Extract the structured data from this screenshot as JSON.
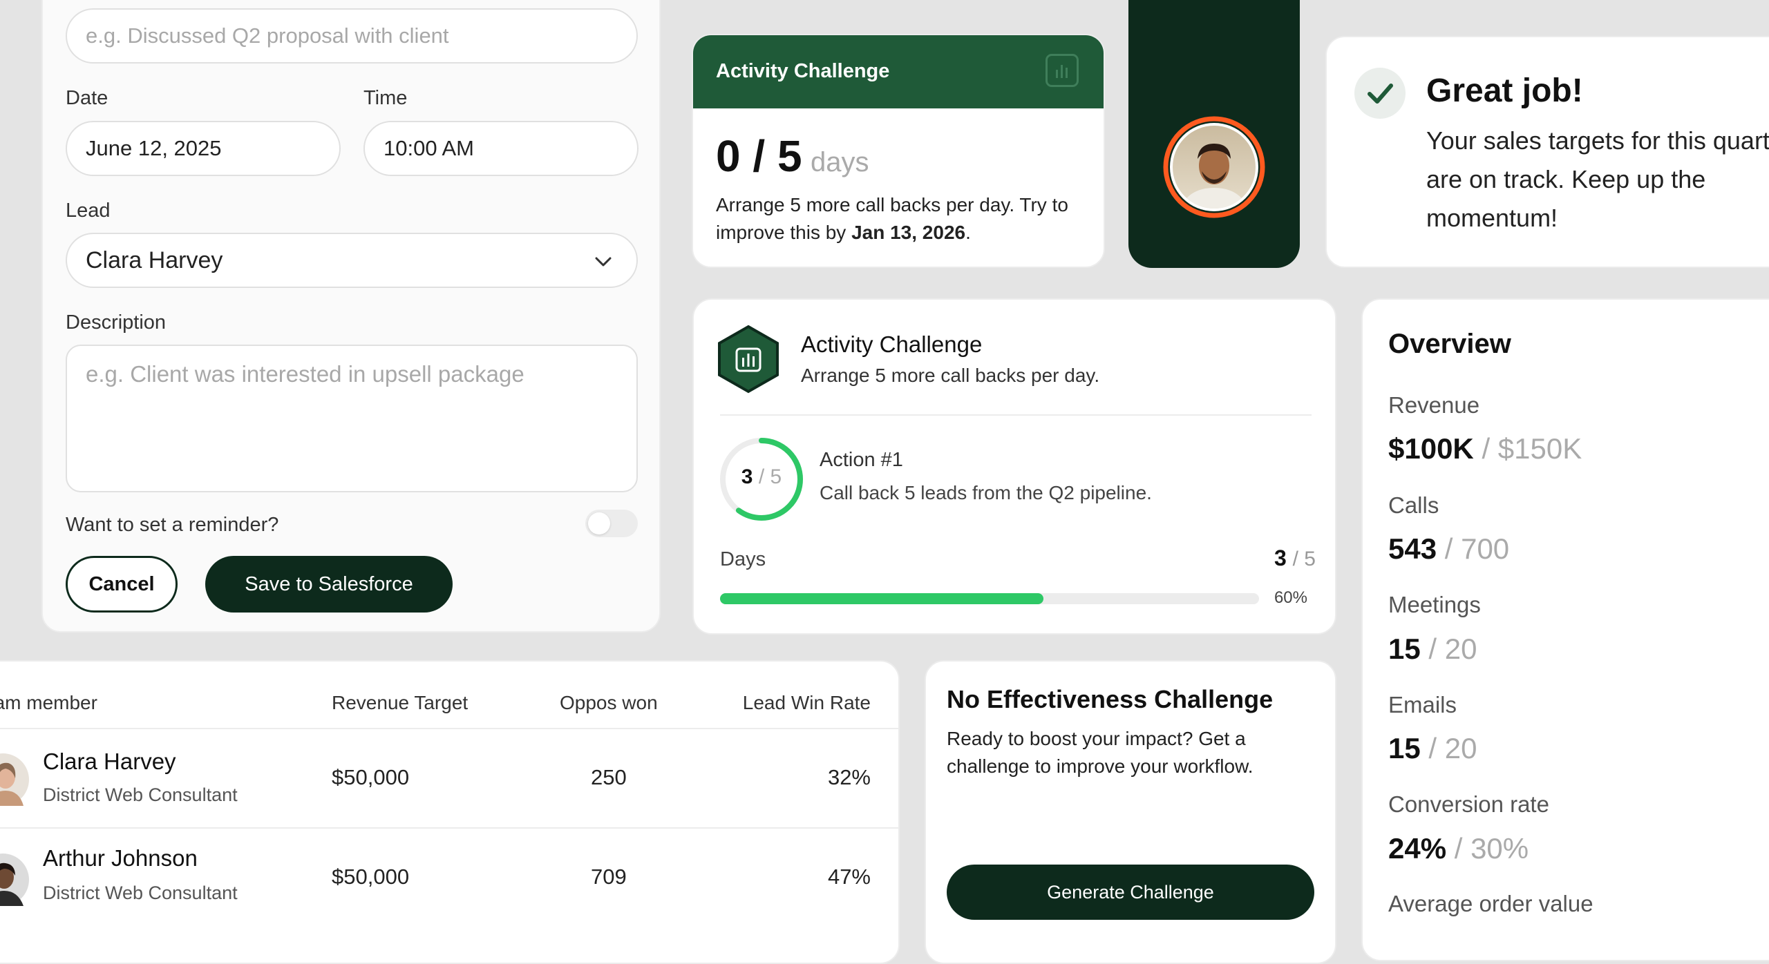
{
  "form": {
    "notes_placeholder": "e.g. Discussed Q2 proposal with client",
    "date_label": "Date",
    "date_value": "June 12, 2025",
    "time_label": "Time",
    "time_value": "10:00 AM",
    "lead_label": "Lead",
    "lead_value": "Clara Harvey",
    "description_label": "Description",
    "description_placeholder": "e.g. Client was interested in upsell package",
    "reminder_label": "Want to set a reminder?",
    "reminder_on": false,
    "cancel_label": "Cancel",
    "save_label": "Save to Salesforce"
  },
  "activity_small": {
    "title": "Activity Challenge",
    "count": "0 / 5",
    "unit": "days",
    "desc_prefix": "Arrange 5 more call backs per day. Try to improve this by ",
    "desc_date": "Jan 13, 2026",
    "desc_suffix": "."
  },
  "great_job": {
    "title": "Great job!",
    "message": "Your sales targets for this quarter are on track. Keep up the momentum!"
  },
  "activity_big": {
    "title": "Activity Challenge",
    "subtitle": "Arrange 5 more call backs per day.",
    "ring_done": "3",
    "ring_total": "/ 5",
    "ring_fraction": 0.6,
    "action_title": "Action #1",
    "action_desc": "Call back 5 leads from the Q2 pipeline.",
    "days_label": "Days",
    "days_done": "3",
    "days_total": "/ 5",
    "days_percent": "60%",
    "progress": 0.6
  },
  "overview": {
    "title": "Overview",
    "metrics": [
      {
        "label": "Revenue",
        "value": "$100K",
        "target": "/ $150K"
      },
      {
        "label": "Calls",
        "value": "543",
        "target": "/ 700"
      },
      {
        "label": "Meetings",
        "value": "15",
        "target": "/ 20"
      },
      {
        "label": "Emails",
        "value": "15",
        "target": "/ 20"
      },
      {
        "label": "Conversion rate",
        "value": "24%",
        "target": "/ 30%"
      },
      {
        "label": "Average order value",
        "value": "",
        "target": ""
      }
    ]
  },
  "table": {
    "headers": [
      "Team member",
      "Revenue Target",
      "Oppos won",
      "Lead Win Rate"
    ],
    "rows": [
      {
        "name": "Clara Harvey",
        "role": "District Web Consultant",
        "revenue": "$50,000",
        "oppos": "250",
        "rate": "32%"
      },
      {
        "name": "Arthur Johnson",
        "role": "District Web Consultant",
        "revenue": "$50,000",
        "oppos": "709",
        "rate": "47%"
      }
    ]
  },
  "no_effectiveness": {
    "title": "No Effectiveness Challenge",
    "desc": "Ready to boost your impact? Get a challenge to improve your workflow.",
    "button": "Generate Challenge"
  },
  "colors": {
    "dark_green": "#0d2a1c",
    "header_green": "#1f5a38",
    "accent_green": "#2ec866",
    "avatar_ring": "#ff5a1f"
  }
}
